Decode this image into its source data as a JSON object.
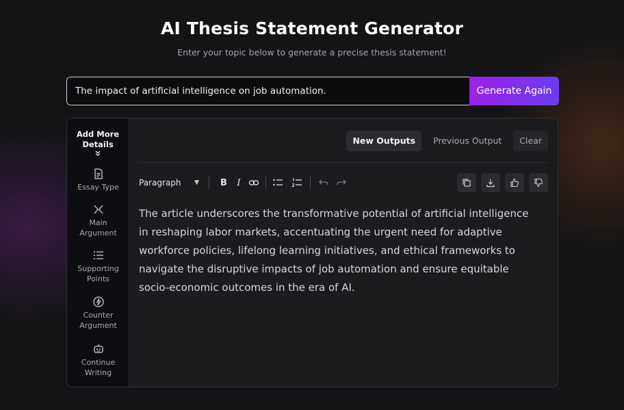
{
  "header": {
    "title": "AI Thesis Statement Generator",
    "subtitle": "Enter your topic below to generate a precise thesis statement!"
  },
  "input": {
    "value": "The impact of artificial intelligence on job automation.",
    "button_label": "Generate Again"
  },
  "sidebar": {
    "more_details_label": "Add More Details",
    "items": [
      {
        "label": "Essay Type",
        "icon": "document-icon"
      },
      {
        "label": "Main Argument",
        "icon": "split-arrows-icon"
      },
      {
        "label": "Supporting Points",
        "icon": "list-icon"
      },
      {
        "label": "Counter Argument",
        "icon": "bolt-icon"
      },
      {
        "label": "Continue Writing",
        "icon": "robot-icon"
      }
    ]
  },
  "tabs": {
    "new_outputs": "New Outputs",
    "previous_output": "Previous Output",
    "clear": "Clear"
  },
  "toolbar": {
    "block_style": "Paragraph",
    "bold": "B",
    "italic": "I"
  },
  "output": {
    "text": "The article underscores the transformative potential of artificial intelligence in reshaping labor markets, accentuating the urgent need for adaptive workforce policies, lifelong learning initiatives, and ethical frameworks to navigate the disruptive impacts of job automation and ensure equitable socio-economic outcomes in the era of AI."
  },
  "colors": {
    "accent_start": "#9b22e6",
    "accent_end": "#6a3cf0",
    "background": "#141416",
    "panel": "#1c1c1f"
  }
}
